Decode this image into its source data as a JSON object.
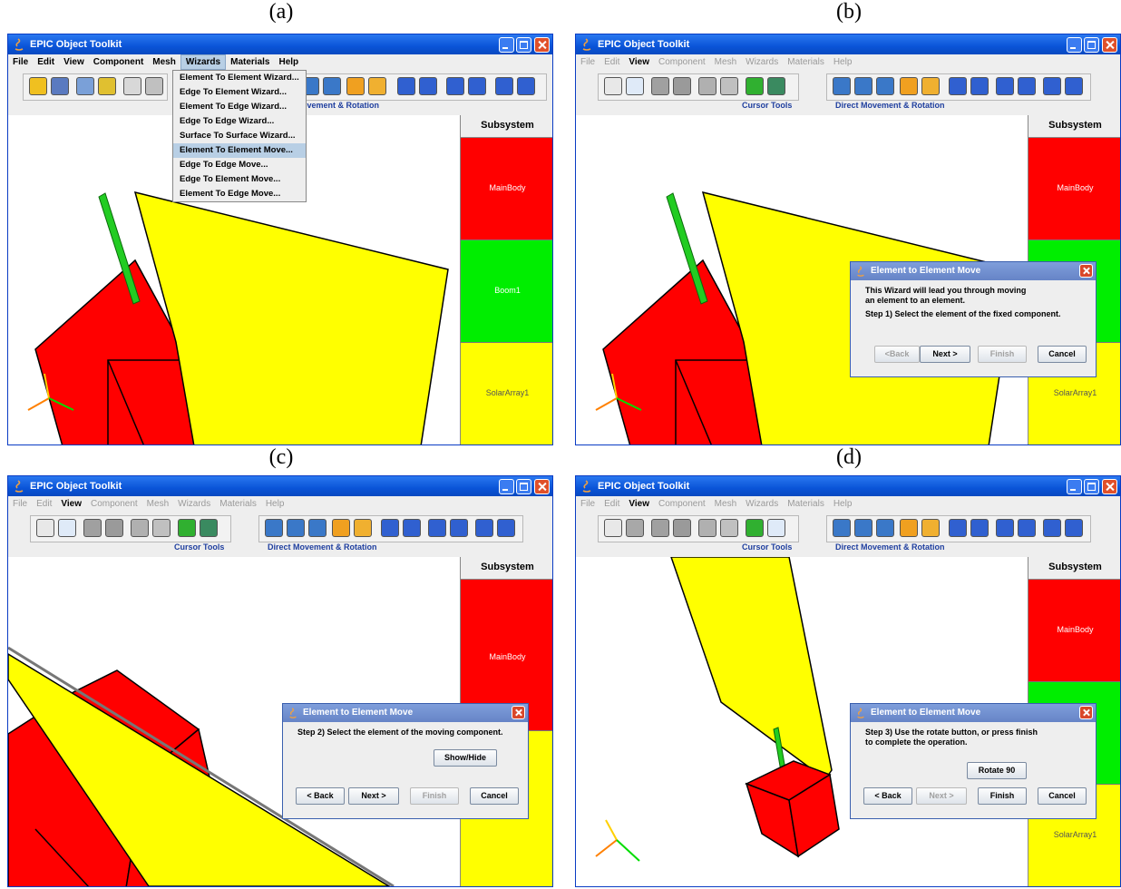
{
  "captions": [
    "(a)",
    "(b)",
    "(c)",
    "(d)"
  ],
  "app": {
    "title": "EPIC Object Toolkit",
    "menus": [
      "File",
      "Edit",
      "View",
      "Component",
      "Mesh",
      "Wizards",
      "Materials",
      "Help"
    ],
    "cursor_tools_label": "Cursor Tools",
    "direct_movement_label": "Direct Movement & Rotation",
    "direct_movement_label_partial": "ovement & Rotation",
    "subsystem_header": "Subsystem",
    "subsystems": [
      "MainBody",
      "Boom1",
      "SolarArray1"
    ]
  },
  "wizards_menu": [
    "Element To Element Wizard...",
    "Edge To Element Wizard...",
    "Element To Edge Wizard...",
    "Edge To Edge Wizard...",
    "Surface To Surface Wizard...",
    "Element To Element Move...",
    "Edge To Edge Move...",
    "Edge To Element Move...",
    "Element To Edge Move..."
  ],
  "wizards_menu_highlighted": "Element To Element Move...",
  "dialog": {
    "title": "Element to Element Move",
    "step1_line1": "This Wizard will lead you through moving",
    "step1_line2": "an element to an element.",
    "step1_line3": "Step 1)  Select the element of the fixed component.",
    "step2": "Step 2)  Select the element of the moving component.",
    "step3_line1": "Step 3)  Use the rotate button, or press finish",
    "step3_line2": "to complete the operation.",
    "show_hide": "Show/Hide",
    "rotate": "Rotate 90",
    "back_b": "<Back",
    "back": "< Back",
    "next": "Next >",
    "finish": "Finish",
    "cancel": "Cancel"
  },
  "colors": {
    "title_blue": "#0a54d8",
    "mainbody": "#ff0000",
    "boom": "#00ee00",
    "solar": "#ffff00"
  }
}
